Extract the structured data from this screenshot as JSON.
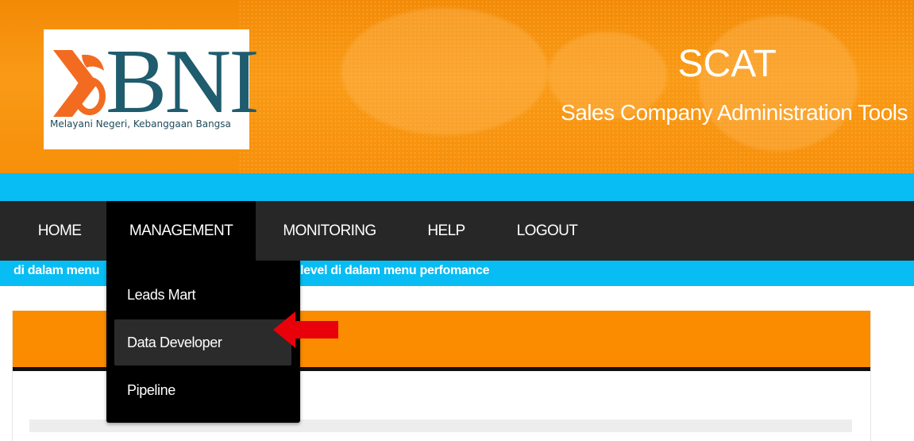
{
  "header": {
    "logo": {
      "wordmark": "BNI",
      "tagline": "Melayani Negeri, Kebanggaan Bangsa"
    },
    "app_title": "SCAT",
    "app_subtitle": "Sales Company Administration Tools"
  },
  "nav": {
    "items": [
      {
        "label": "HOME"
      },
      {
        "label": "MANAGEMENT"
      },
      {
        "label": "MONITORING"
      },
      {
        "label": "HELP"
      },
      {
        "label": "LOGOUT"
      }
    ],
    "active": "MANAGEMENT"
  },
  "marquee": {
    "text_left": "di dalam menu",
    "text_right": "level di dalam menu perfomance"
  },
  "dropdown": {
    "items": [
      {
        "label": "Leads Mart"
      },
      {
        "label": "Data Developer"
      },
      {
        "label": "Pipeline"
      }
    ],
    "highlighted": "Data Developer"
  },
  "colors": {
    "header_orange": "#f78f0a",
    "cyan": "#07bdf4",
    "nav_dark": "#272727",
    "dropdown_black": "#000000",
    "panel_orange": "#fb8c00",
    "logo_teal": "#1e5c6e",
    "logo_orange": "#f26b21",
    "annotation_red": "#e8000b"
  },
  "icons": {
    "logo_mark": "bni-46-logo-icon",
    "annotation": "red-arrow-icon"
  }
}
